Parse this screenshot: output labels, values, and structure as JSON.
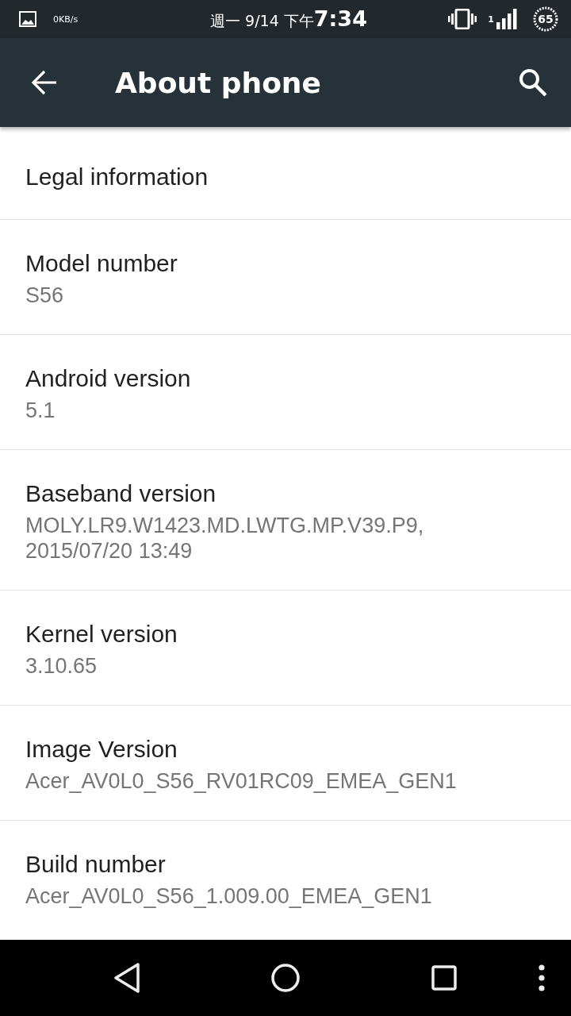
{
  "status_bar": {
    "network_speed": "0KB/s",
    "date": "週一 9/14 下午",
    "time": "7:34",
    "sim_slot": "1",
    "battery": "65"
  },
  "app_bar": {
    "title": "About phone"
  },
  "settings": [
    {
      "title": "Legal information"
    },
    {
      "title": "Model number",
      "summary": "S56"
    },
    {
      "title": "Android version",
      "summary": "5.1"
    },
    {
      "title": "Baseband version",
      "summary": "MOLY.LR9.W1423.MD.LWTG.MP.V39.P9,\n2015/07/20 13:49"
    },
    {
      "title": "Kernel version",
      "summary": "3.10.65"
    },
    {
      "title": "Image Version",
      "summary": "Acer_AV0L0_S56_RV01RC09_EMEA_GEN1"
    },
    {
      "title": "Build number",
      "summary": "Acer_AV0L0_S56_1.009.00_EMEA_GEN1"
    }
  ]
}
